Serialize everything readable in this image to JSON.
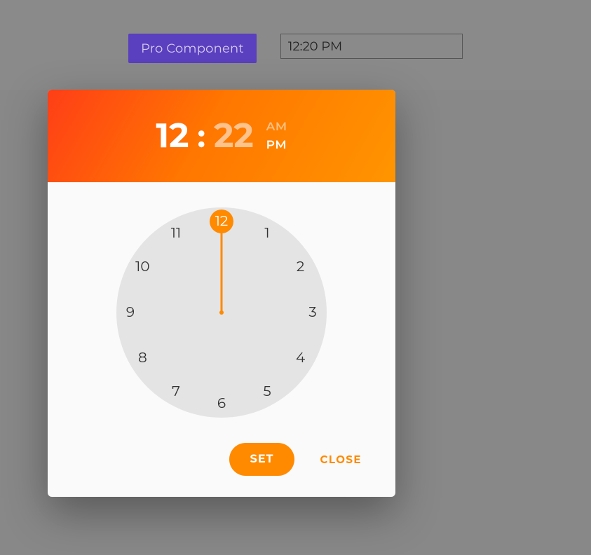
{
  "topbar": {
    "badge_label": "Pro Component",
    "time_value": "12:20 PM"
  },
  "picker": {
    "hour": "12",
    "colon": ":",
    "minute": "22",
    "am_label": "AM",
    "pm_label": "PM",
    "selected_meridiem": "PM",
    "clock": {
      "numbers": [
        "12",
        "1",
        "2",
        "3",
        "4",
        "5",
        "6",
        "7",
        "8",
        "9",
        "10",
        "11"
      ],
      "selected_hour": "12",
      "hand_angle_deg": 0
    },
    "actions": {
      "set_label": "SET",
      "close_label": "CLOSE"
    }
  },
  "colors": {
    "accent": "#ff8a00",
    "badge_bg": "#5a3fbf"
  }
}
